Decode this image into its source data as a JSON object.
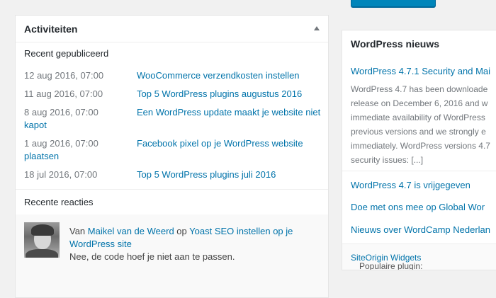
{
  "activity": {
    "title": "Activiteiten",
    "recent_published_title": "Recent gepubliceerd",
    "posts": [
      {
        "date": "12 aug 2016, 07:00",
        "title": "WooCommerce verzendkosten instellen"
      },
      {
        "date": "11 aug 2016, 07:00",
        "title": "Top 5 WordPress plugins augustus 2016"
      },
      {
        "date": "8 aug 2016, 07:00",
        "title": "Een WordPress update maakt je website niet",
        "title_cont": "kapot"
      },
      {
        "date": "1 aug 2016, 07:00",
        "title": "Facebook pixel op je WordPress website",
        "title_cont": "plaatsen"
      },
      {
        "date": "18 jul 2016, 07:00",
        "title": "Top 5 WordPress plugins juli 2016"
      }
    ],
    "recent_comments_title": "Recente reacties",
    "comment": {
      "prefix": "Van",
      "author": "Maikel van de Weerd",
      "on": "op",
      "post": "Yoast SEO instellen op je",
      "post_cont": "WordPress site",
      "text": "Nee, de code hoef je niet aan te passen."
    }
  },
  "news": {
    "title": "WordPress nieuws",
    "main_item_title": "WordPress 4.7.1 Security and Mai",
    "main_item_body": [
      "WordPress 4.7 has been downloade",
      "release on December 6, 2016 and w",
      "immediate availability of WordPress",
      "previous versions and we strongly e",
      "immediately. WordPress versions 4.7",
      "security issues: [...]"
    ],
    "links": [
      "WordPress 4.7 is vrijgegeven",
      "Doe met ons mee op Global Wor",
      "Nieuws over WordCamp Nederlan"
    ],
    "popular_prefix": "Populaire plugin:",
    "popular_plugin": "SiteOrigin Widgets"
  },
  "colors": {
    "link": "#0073aa",
    "accent_button": "#0085ba"
  }
}
